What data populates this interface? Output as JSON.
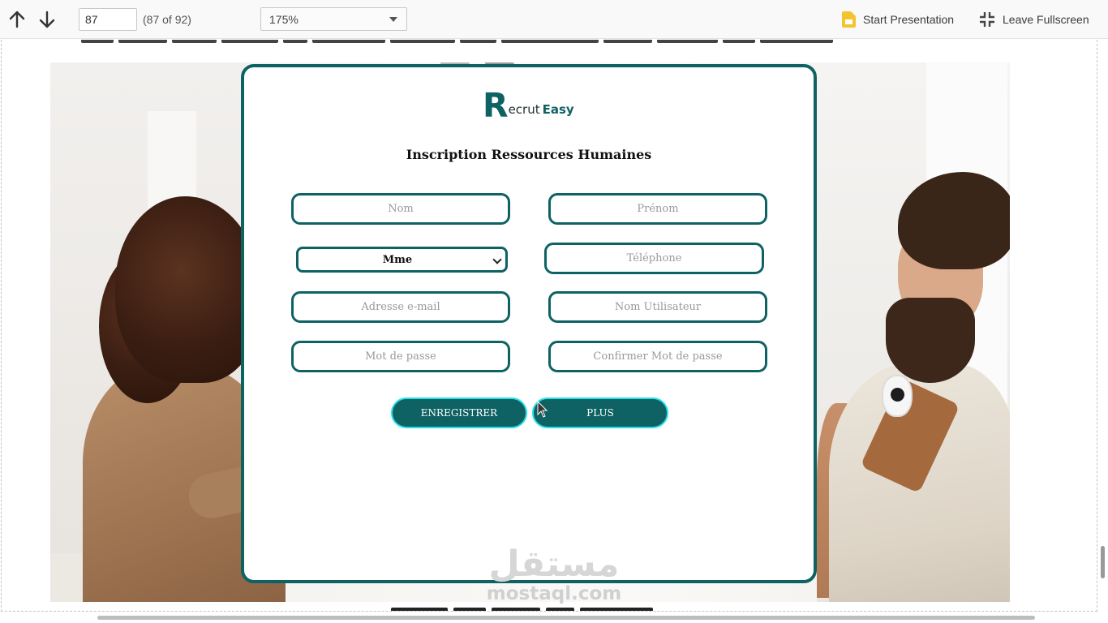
{
  "toolbar": {
    "page_number": "87",
    "page_count": "(87 of 92)",
    "zoom": "175%",
    "start_presentation": "Start Presentation",
    "leave_fullscreen": "Leave Fullscreen",
    "icons": {
      "up": "arrow-up-icon",
      "down": "arrow-down-icon",
      "presentation": "slides-icon",
      "fullscreen": "exit-fullscreen-icon"
    }
  },
  "form": {
    "logo_r": "R",
    "logo_ecrut": "ecrut",
    "logo_easy": "Easy",
    "title": "Inscription Ressources Humaines",
    "fields": {
      "nom": "Nom",
      "prenom": "Prénom",
      "civilite": "Mme",
      "telephone": "Téléphone",
      "email": "Adresse e-mail",
      "username": "Nom Utilisateur",
      "password": "Mot de passe",
      "confirm_password": "Confirmer Mot de passe"
    },
    "buttons": {
      "register": "ENREGISTRER",
      "more": "PLUS"
    }
  },
  "watermark": {
    "arabic": "مستقل",
    "latin": "mostaql.com"
  },
  "colors": {
    "brand_teal": "#0f6264",
    "button_glow": "#29e0e8",
    "logo_easy": "#0f6264",
    "presentation_icon": "#f4c430"
  }
}
